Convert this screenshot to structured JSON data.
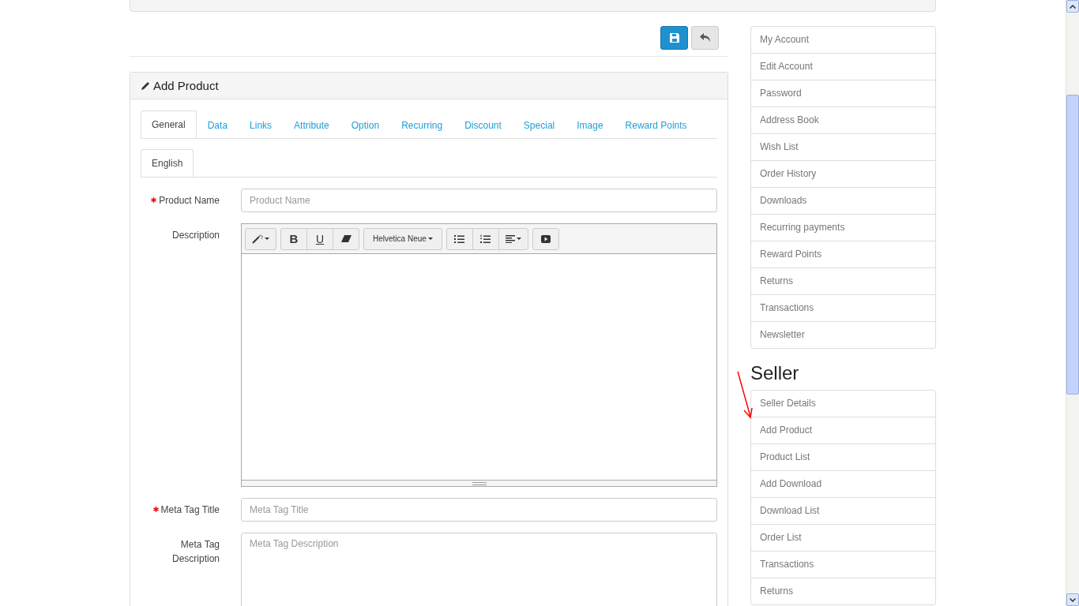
{
  "panel": {
    "title": "Add Product",
    "tabs": [
      {
        "label": "General",
        "selected": true
      },
      {
        "label": "Data",
        "selected": false
      },
      {
        "label": "Links",
        "selected": false
      },
      {
        "label": "Attribute",
        "selected": false
      },
      {
        "label": "Option",
        "selected": false
      },
      {
        "label": "Recurring",
        "selected": false
      },
      {
        "label": "Discount",
        "selected": false
      },
      {
        "label": "Special",
        "selected": false
      },
      {
        "label": "Image",
        "selected": false
      },
      {
        "label": "Reward Points",
        "selected": false
      }
    ],
    "language_tabs": [
      {
        "label": "English",
        "selected": true
      }
    ],
    "fields": [
      {
        "kind": "input",
        "label": "Product Name",
        "required": true,
        "placeholder": "Product Name"
      },
      {
        "kind": "editor",
        "label": "Description",
        "required": false,
        "toolbar_groups": [
          {
            "buttons": [
              {
                "kind": "style"
              }
            ]
          },
          {
            "buttons": [
              {
                "kind": "bold",
                "label": "B"
              },
              {
                "kind": "underline",
                "label": "U"
              },
              {
                "kind": "clear"
              }
            ]
          },
          {
            "buttons": [
              {
                "kind": "font",
                "label": "Helvetica Neue"
              }
            ]
          },
          {
            "buttons": [
              {
                "kind": "bullets"
              },
              {
                "kind": "numbers"
              },
              {
                "kind": "align"
              }
            ]
          },
          {
            "buttons": [
              {
                "kind": "video"
              }
            ]
          }
        ]
      },
      {
        "kind": "input",
        "label": "Meta Tag Title",
        "required": true,
        "placeholder": "Meta Tag Title"
      },
      {
        "kind": "textarea",
        "label": "Meta Tag Description",
        "required": false,
        "placeholder": "Meta Tag Description"
      }
    ]
  },
  "account_menu": {
    "items": [
      {
        "label": "My Account"
      },
      {
        "label": "Edit Account"
      },
      {
        "label": "Password"
      },
      {
        "label": "Address Book"
      },
      {
        "label": "Wish List"
      },
      {
        "label": "Order History"
      },
      {
        "label": "Downloads"
      },
      {
        "label": "Recurring payments"
      },
      {
        "label": "Reward Points"
      },
      {
        "label": "Returns"
      },
      {
        "label": "Transactions"
      },
      {
        "label": "Newsletter"
      }
    ]
  },
  "seller_menu": {
    "heading": "Seller",
    "items": [
      {
        "label": "Seller Details"
      },
      {
        "label": "Add Product"
      },
      {
        "label": "Product List"
      },
      {
        "label": "Add Download"
      },
      {
        "label": "Download List"
      },
      {
        "label": "Order List"
      },
      {
        "label": "Transactions"
      },
      {
        "label": "Returns"
      }
    ]
  }
}
